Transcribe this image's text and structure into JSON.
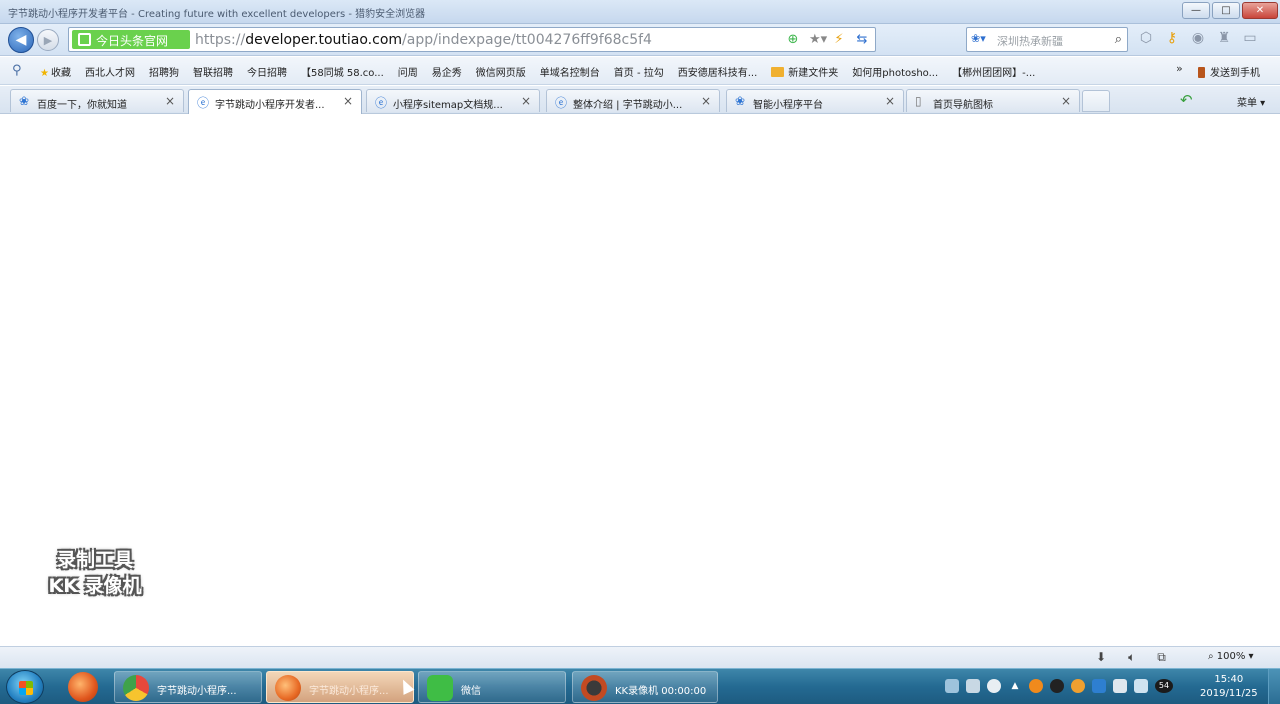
{
  "window": {
    "title": "字节跳动小程序开发者平台 - Creating future with excellent developers - 猎豹安全浏览器",
    "min_label": "—",
    "max_label": "□",
    "close_label": "✕"
  },
  "navigation": {
    "back_icon": "back-arrow-icon",
    "forward_icon": "forward-arrow-icon",
    "site_badge": "今日头条官网",
    "url_scheme": "https://",
    "url_host": "developer.toutiao.com",
    "url_path": "/app/indexpage/tt004276ff9f68c5f4",
    "search_engine_label": "❀▾",
    "search_placeholder": "深圳热承新疆"
  },
  "favorites": {
    "items": [
      {
        "label": "收藏",
        "type": "star"
      },
      {
        "label": "西北人才网",
        "type": "plain"
      },
      {
        "label": "招聘狗",
        "type": "plain"
      },
      {
        "label": "智联招聘",
        "type": "plain"
      },
      {
        "label": "今日招聘",
        "type": "plain"
      },
      {
        "label": "【58同城 58.co...",
        "type": "plain"
      },
      {
        "label": "问周",
        "type": "plain"
      },
      {
        "label": "易企秀",
        "type": "plain"
      },
      {
        "label": "微信网页版",
        "type": "plain"
      },
      {
        "label": "单域名控制台",
        "type": "plain"
      },
      {
        "label": "首页 - 拉勾",
        "type": "plain"
      },
      {
        "label": "西安德居科技有...",
        "type": "plain"
      },
      {
        "label": "新建文件夹",
        "type": "folder"
      },
      {
        "label": "如何用photosho...",
        "type": "plain"
      },
      {
        "label": "【郴州团团网】-...",
        "type": "plain"
      }
    ],
    "more_label": "»",
    "send_to_phone": "发送到手机"
  },
  "tabs": [
    {
      "label": "百度一下，你就知道",
      "icon": "baidu-icon",
      "active": false
    },
    {
      "label": "字节跳动小程序开发者...",
      "icon": "ie-icon",
      "active": true
    },
    {
      "label": "小程序sitemap文档规...",
      "icon": "ie-icon",
      "active": false
    },
    {
      "label": "整体介绍 | 字节跳动小...",
      "icon": "ie-icon",
      "active": false
    },
    {
      "label": "智能小程序平台",
      "icon": "baidu-icon",
      "active": false
    },
    {
      "label": "首页导航图标",
      "icon": "page-icon",
      "active": false
    }
  ],
  "tab_close_label": "×",
  "menu_label": "菜单 ▾",
  "watermark": {
    "line1": "录制工具",
    "line2": "KK 录像机"
  },
  "statusbar": {
    "zoom": "100% ▾"
  },
  "taskbar": {
    "tasks": [
      {
        "label": "字节跳动小程序...",
        "active": false,
        "icon_color": "#e7483c"
      },
      {
        "label": "字节跳动小程序...",
        "active": true,
        "icon_color": "#f0823a"
      },
      {
        "label": "微信",
        "active": false,
        "icon_color": "#3fbd45"
      },
      {
        "label": "KK录像机 00:00:00",
        "active": false,
        "icon_color": "#c24a22"
      }
    ],
    "clock_time": "15:40",
    "clock_date": "2019/11/25",
    "tray_badge": "54"
  }
}
